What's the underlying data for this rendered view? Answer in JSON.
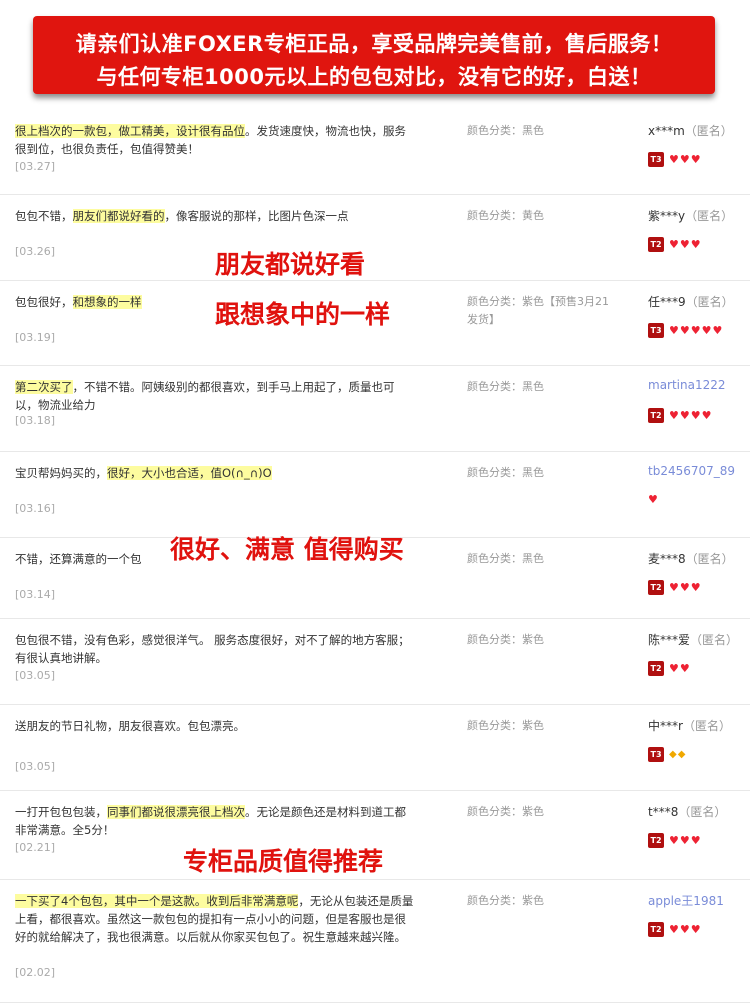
{
  "banner": {
    "line1": "请亲们认准FOXER专柜正品，享受品牌完美售前，售后服务！",
    "line2": "与任何专柜1000元以上的包包对比，没有它的好，白送！"
  },
  "reviews": [
    {
      "segments": [
        {
          "t": "很上档次的一款包，做工精美，设计很有品位",
          "h": true
        },
        {
          "t": "。发货速度快，物流也快，服务很到位，也很负责任，包值得赞美！",
          "h": false
        }
      ],
      "date": "[03.27]",
      "variant": "颜色分类：黑色",
      "user": "x***m",
      "anon": "（匿名）",
      "level": "T3",
      "hearts": 3,
      "icon": "heart"
    },
    {
      "segments": [
        {
          "t": "包包不错，",
          "h": false
        },
        {
          "t": "朋友们都说好看的",
          "h": true
        },
        {
          "t": "，像客服说的那样，比图片色深一点",
          "h": false
        }
      ],
      "date": "[03.26]",
      "variant": "颜色分类：黄色",
      "user": "紫***y",
      "anon": "（匿名）",
      "level": "T2",
      "hearts": 3,
      "icon": "heart"
    },
    {
      "segments": [
        {
          "t": "包包很好，",
          "h": false
        },
        {
          "t": "和想象的一样",
          "h": true
        }
      ],
      "date": "[03.19]",
      "variant": "颜色分类：紫色【预售3月21发货】",
      "user": "任***9",
      "anon": "（匿名）",
      "level": "T3",
      "hearts": 5,
      "icon": "heart"
    },
    {
      "segments": [
        {
          "t": "第二次买了",
          "h": true
        },
        {
          "t": "，不错不错。阿姨级别的都很喜欢，到手马上用起了，质量也可以，物流业给力",
          "h": false
        }
      ],
      "date": "[03.18]",
      "variant": "颜色分类：黑色",
      "user": "martina1222",
      "anon": "",
      "level": "T2",
      "hearts": 4,
      "icon": "heart"
    },
    {
      "segments": [
        {
          "t": "宝贝帮妈妈买的，",
          "h": false
        },
        {
          "t": "很好，大小也合适，值O(∩_∩)O",
          "h": true
        }
      ],
      "date": "[03.16]",
      "variant": "颜色分类：黑色",
      "user": "tb2456707_89",
      "anon": "",
      "level": "",
      "hearts": 1,
      "icon": "heart"
    },
    {
      "segments": [
        {
          "t": "不错，还算满意的一个包",
          "h": false
        }
      ],
      "date": "[03.14]",
      "variant": "颜色分类：黑色",
      "user": "麦***8",
      "anon": "（匿名）",
      "level": "T2",
      "hearts": 3,
      "icon": "heart"
    },
    {
      "segments": [
        {
          "t": "包包很不错，没有色彩，感觉很洋气。 服务态度很好，对不了解的地方客服；有很认真地讲解。",
          "h": false
        }
      ],
      "date": "[03.05]",
      "variant": "颜色分类：紫色",
      "user": "陈***爱",
      "anon": "（匿名）",
      "level": "T2",
      "hearts": 2,
      "icon": "heart"
    },
    {
      "segments": [
        {
          "t": "送朋友的节日礼物，朋友很喜欢。包包漂亮。",
          "h": false
        }
      ],
      "date": "[03.05]",
      "variant": "颜色分类：紫色",
      "user": "中***r",
      "anon": "（匿名）",
      "level": "T3",
      "hearts": 2,
      "icon": "diamond"
    },
    {
      "segments": [
        {
          "t": "一打开包包包装，",
          "h": false
        },
        {
          "t": "同事们都说很漂亮很上档次",
          "h": true
        },
        {
          "t": "。无论是颜色还是材料到道工都非常满意。全5分！",
          "h": false
        }
      ],
      "date": "[02.21]",
      "variant": "颜色分类：紫色",
      "user": "t***8",
      "anon": "（匿名）",
      "level": "T2",
      "hearts": 3,
      "icon": "heart"
    },
    {
      "segments": [
        {
          "t": "一下买了4个包包，其中一个是这款。收到后非常满意呢",
          "h": true
        },
        {
          "t": "，无论从包装还是质量上看，都很喜欢。虽然这一款包包的提扣有一点小小的问题，但是客服也是很好的就给解决了，我也很满意。以后就从你家买包包了。祝生意越来越兴隆。",
          "h": false
        }
      ],
      "date": "[02.02]",
      "variant": "颜色分类：紫色",
      "user": "apple王1981",
      "anon": "",
      "level": "T2",
      "hearts": 3,
      "icon": "heart"
    }
  ],
  "overlays": {
    "o1": "朋友都说好看",
    "o2": "跟想象中的一样",
    "o3": "很好、满意 值得购买",
    "o4": "专柜品质值得推荐"
  }
}
